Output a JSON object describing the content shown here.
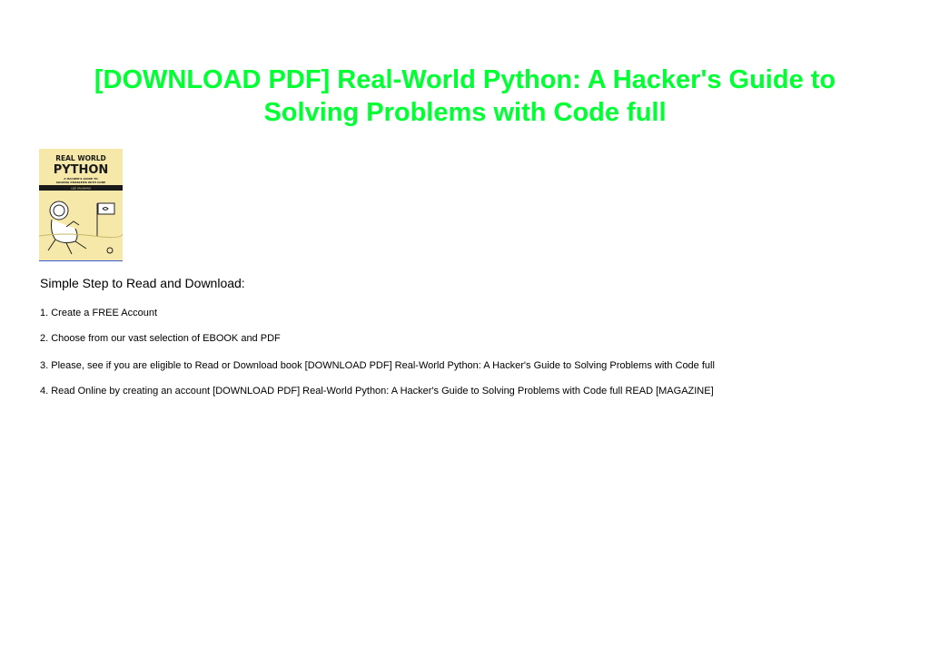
{
  "document": {
    "title": "[DOWNLOAD PDF] Real-World Python: A Hacker's Guide to Solving Problems with Code full",
    "steps_heading": "Simple Step to Read and Download:",
    "steps": [
      "1. Create a FREE Account",
      "2. Choose from our vast selection of EBOOK and PDF",
      "3. Please, see if you are eligible to Read or Download book [DOWNLOAD PDF] Real-World Python: A Hacker's Guide to Solving Problems with Code full",
      "4. Read Online by creating an account [DOWNLOAD PDF] Real-World Python: A Hacker's Guide to Solving Problems with Code full READ [MAGAZINE]"
    ]
  },
  "cover": {
    "line1": "REAL WORLD",
    "line2": "PYTHON",
    "subtitle1": "A HACKER'S GUIDE TO",
    "subtitle2": "SOLVING PROBLEMS WITH CODE",
    "author": "LEE VAUGHAN",
    "background_color": "#f6e8a9",
    "band_color": "#1a1a1a"
  },
  "colors": {
    "title": "#00ff33",
    "text": "#000000",
    "background": "#ffffff"
  }
}
